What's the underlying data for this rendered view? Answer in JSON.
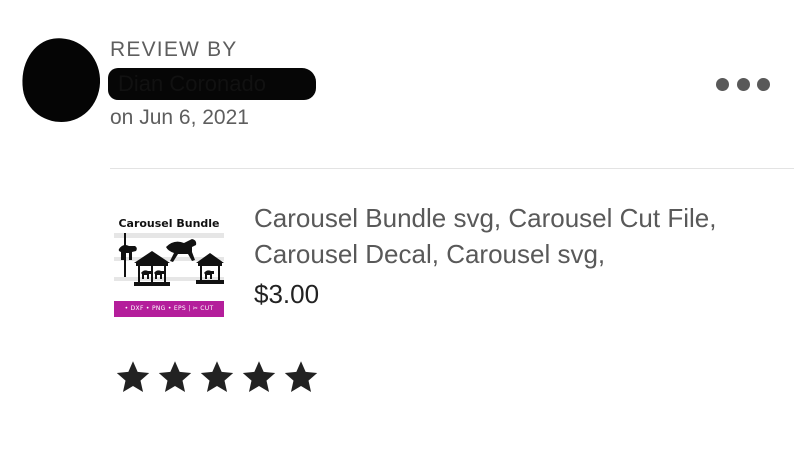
{
  "review": {
    "header_label": "REVIEW BY",
    "reviewer_name": "Dian Coronado",
    "date": "on Jun 6, 2021",
    "more_icon": "more-horizontal-icon"
  },
  "listing": {
    "title": "Carousel Bundle svg, Carousel Cut File, Carousel Decal, Carousel svg,",
    "price": "$3.00",
    "thumbnail": {
      "title": "Carousel Bundle",
      "band_text": "• DXF • PNG • EPS | ✂ CUT"
    }
  },
  "rating": {
    "value": 5,
    "max": 5,
    "star_color": "#222222"
  }
}
